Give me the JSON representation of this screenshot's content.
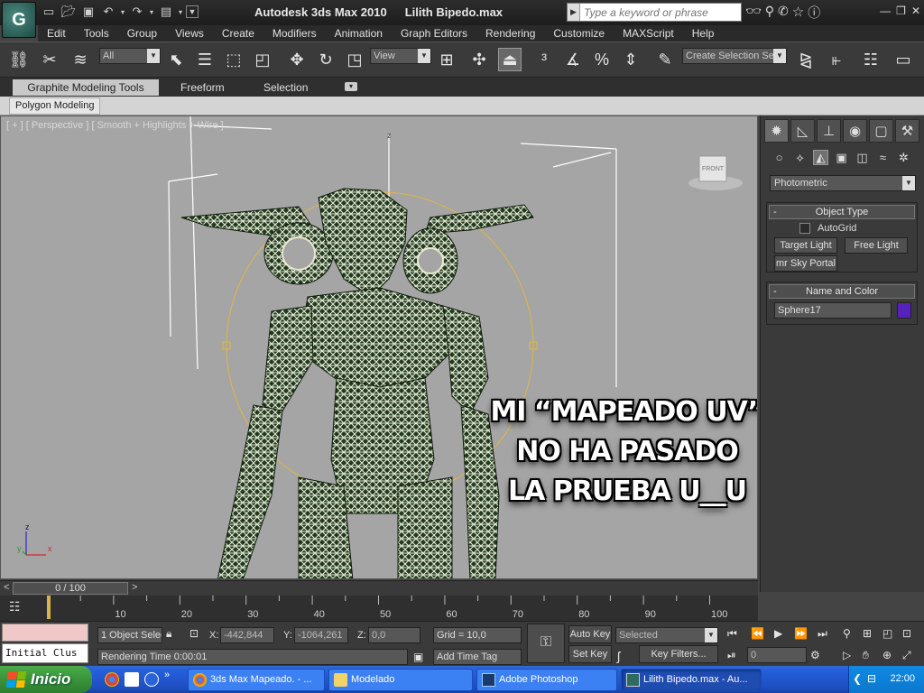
{
  "titlebar": {
    "app_title": "Autodesk 3ds Max  2010",
    "file_name": "Lilith Bipedo.max",
    "search_placeholder": "Type a keyword or phrase",
    "logo_icon": "3ds-max-logo-icon"
  },
  "menu": {
    "items": [
      "Edit",
      "Tools",
      "Group",
      "Views",
      "Create",
      "Modifiers",
      "Animation",
      "Graph Editors",
      "Rendering",
      "Customize",
      "MAXScript",
      "Help"
    ]
  },
  "toolbar": {
    "selection_filter": "All",
    "ref_coord": "View",
    "named_selection_placeholder": "Create Selection Se"
  },
  "ribbon": {
    "tabs": [
      "Graphite Modeling Tools",
      "Freeform",
      "Selection"
    ],
    "panel_label": "Polygon Modeling"
  },
  "viewport": {
    "label": "[ + ] [ Perspective ] [ Smooth + Highlights + Wire ]",
    "caption_lines": [
      "MI “MAPEADO UV”",
      "NO HA PASADO",
      "LA PRUEBA U__U"
    ],
    "viewcube_label": "FRONT",
    "axis_x": "x",
    "axis_y": "y",
    "axis_z": "z",
    "gizmo_z": "z"
  },
  "command_panel": {
    "subcategory": "Photometric",
    "object_type": {
      "title": "Object Type",
      "autogrid_label": "AutoGrid",
      "autogrid_checked": false,
      "buttons": [
        "Target Light",
        "Free Light",
        "mr Sky Portal"
      ]
    },
    "name_and_color": {
      "title": "Name and Color",
      "name_value": "Sphere17",
      "color": "#5522bb"
    }
  },
  "time_slider": {
    "frame_display": "0 / 100",
    "prev_arrow": "<",
    "next_arrow": ">",
    "ticks": [
      "0",
      "10",
      "20",
      "30",
      "40",
      "50",
      "60",
      "70",
      "80",
      "90",
      "100"
    ]
  },
  "status": {
    "maxscript_listener": "Initial Clus",
    "selection_info": "1 Object Selec",
    "x_label": "X:",
    "x_value": "-442,844",
    "y_label": "Y:",
    "y_value": "-1064,261",
    "z_label": "Z:",
    "z_value": "0,0",
    "grid": "Grid = 10,0",
    "render_time": "Rendering Time  0:00:01",
    "add_time_tag": "Add Time Tag",
    "auto_key": "Auto Key",
    "set_key": "Set Key",
    "key_mode": "Selected",
    "key_filters": "Key Filters...",
    "current_frame": "0"
  },
  "taskbar": {
    "start_label": "Inicio",
    "windows": [
      {
        "label": "3ds Max Mapeado. - ...",
        "icon": "chrome-icon"
      },
      {
        "label": "Modelado",
        "icon": "folder-icon"
      },
      {
        "label": "Adobe Photoshop",
        "icon": "photoshop-icon"
      },
      {
        "label": "Lilith Bipedo.max - Au...",
        "icon": "3ds-max-icon",
        "active": true
      }
    ],
    "clock": "22:00"
  }
}
